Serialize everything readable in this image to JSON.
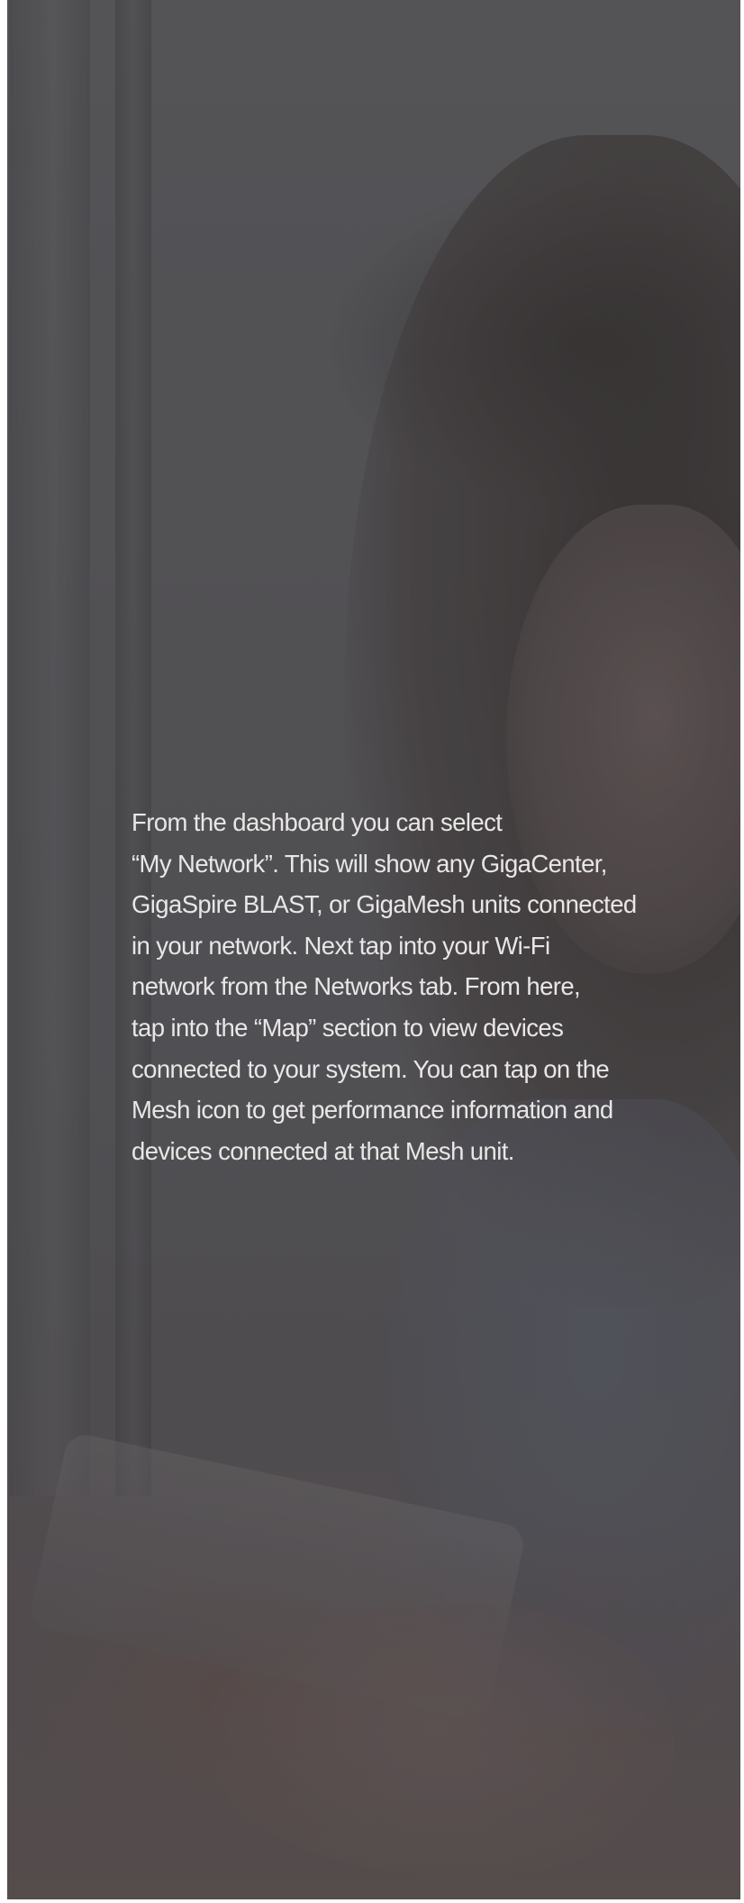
{
  "background": {
    "description_icon": "woman-using-tablet-photo",
    "overlay_color": "#555458",
    "text_color": "#e9e6e6"
  },
  "content": {
    "paragraph": "From the dashboard you can select\n“My Network”. This will show any GigaCenter,\nGigaSpire BLAST, or GigaMesh units connected\nin your network. Next tap into your Wi-Fi\nnetwork from the Networks tab. From here,\ntap into the “Map” section to view devices\nconnected to your system. You can tap on the\nMesh icon to get performance information and\ndevices connected at that Mesh unit."
  }
}
